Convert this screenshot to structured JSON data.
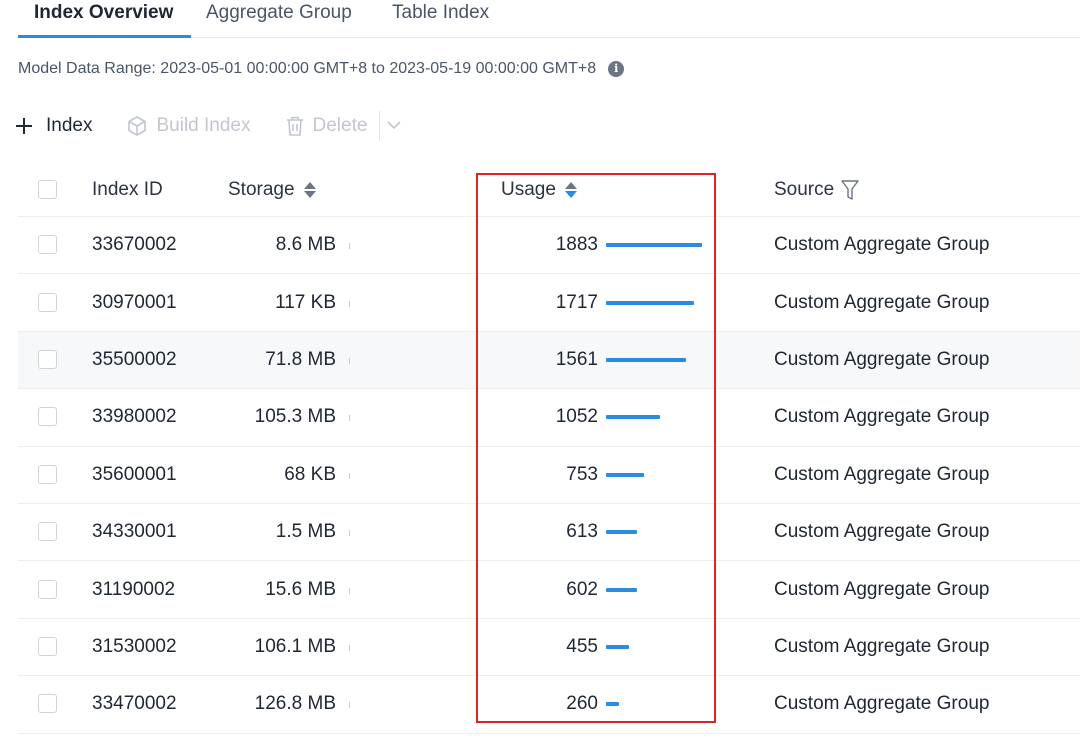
{
  "tabs": [
    {
      "label": "Index Overview",
      "active": true
    },
    {
      "label": "Aggregate Group",
      "active": false
    },
    {
      "label": "Table Index",
      "active": false
    }
  ],
  "range_text": "Model Data Range: 2023-05-01 00:00:00 GMT+8 to 2023-05-19 00:00:00 GMT+8",
  "toolbar": {
    "add_label": "Index",
    "build_label": "Build Index",
    "delete_label": "Delete"
  },
  "table": {
    "headers": {
      "id": "Index ID",
      "storage": "Storage",
      "usage": "Usage",
      "source": "Source"
    },
    "rows": [
      {
        "id": "33670002",
        "storage": "8.6 MB",
        "usage": "1883",
        "source": "Custom Aggregate Group"
      },
      {
        "id": "30970001",
        "storage": "117 KB",
        "usage": "1717",
        "source": "Custom Aggregate Group"
      },
      {
        "id": "35500002",
        "storage": "71.8 MB",
        "usage": "1561",
        "source": "Custom Aggregate Group"
      },
      {
        "id": "33980002",
        "storage": "105.3 MB",
        "usage": "1052",
        "source": "Custom Aggregate Group"
      },
      {
        "id": "35600001",
        "storage": "68 KB",
        "usage": "753",
        "source": "Custom Aggregate Group"
      },
      {
        "id": "34330001",
        "storage": "1.5 MB",
        "usage": "613",
        "source": "Custom Aggregate Group"
      },
      {
        "id": "31190002",
        "storage": "15.6 MB",
        "usage": "602",
        "source": "Custom Aggregate Group"
      },
      {
        "id": "31530002",
        "storage": "106.1 MB",
        "usage": "455",
        "source": "Custom Aggregate Group"
      },
      {
        "id": "33470002",
        "storage": "126.8 MB",
        "usage": "260",
        "source": "Custom Aggregate Group"
      }
    ]
  },
  "colors": {
    "accent": "#2a8ce0",
    "highlight": "#e02424"
  }
}
